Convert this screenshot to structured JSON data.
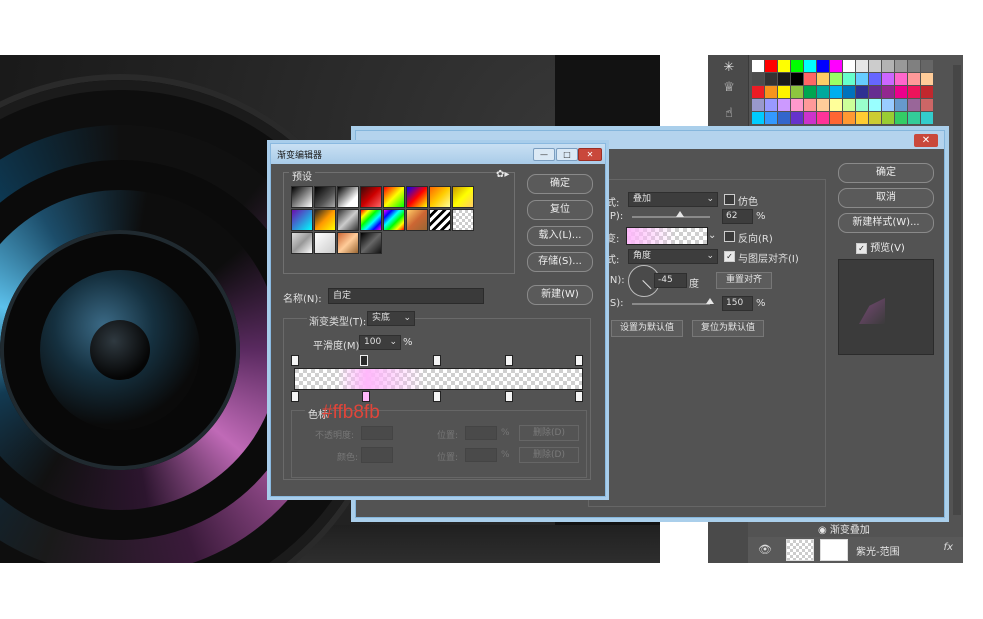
{
  "gradient_editor": {
    "title": "渐变编辑器",
    "win_buttons": [
      "—",
      "□",
      "✕"
    ],
    "presets_label": "预设",
    "buttons": {
      "ok": "确定",
      "reset": "复位",
      "load": "载入(L)...",
      "save": "存储(S)...",
      "new": "新建(W)"
    },
    "name_label": "名称(N):",
    "name_value": "自定",
    "type_label": "渐变类型(T):",
    "type_value": "实底",
    "smooth_label": "平滑度(M):",
    "smooth_value": "100",
    "smooth_unit": "%",
    "stops_label": "色标",
    "opacity_label": "不透明度:",
    "color_label": "颜色:",
    "location_label": "位置:",
    "percent": "%",
    "delete_label": "删除(D)"
  },
  "layer_style": {
    "blend_mode_label": "式:",
    "blend_mode_value": "叠加",
    "dither_label": "仿色",
    "opacity_label": "(P):",
    "opacity_value": "62",
    "percent": "%",
    "gradient_label": "变:",
    "reverse_label": "反向(R)",
    "style_label": "式:",
    "style_value": "角度",
    "align_label": "与图层对齐(I)",
    "angle_label": "(N):",
    "angle_value": "-45",
    "angle_unit": "度",
    "reset_align": "重置对齐",
    "scale_label": "(S):",
    "scale_value": "150",
    "make_default": "设置为默认值",
    "reset_default": "复位为默认值",
    "buttons": {
      "ok": "确定",
      "cancel": "取消",
      "new_style": "新建样式(W)...",
      "preview": "预览(V)"
    },
    "close": "✕"
  },
  "layers": {
    "effect_name": "渐变叠加",
    "layer_name": "紫光-范围",
    "fx": "fx"
  },
  "annotation": "#ffb8fb",
  "colors": {
    "gradient_pink": "#ffb8fb",
    "dialog_bg": "#535353",
    "title_blue": "#b4d3ed",
    "annotation_red": "#e0453a"
  }
}
